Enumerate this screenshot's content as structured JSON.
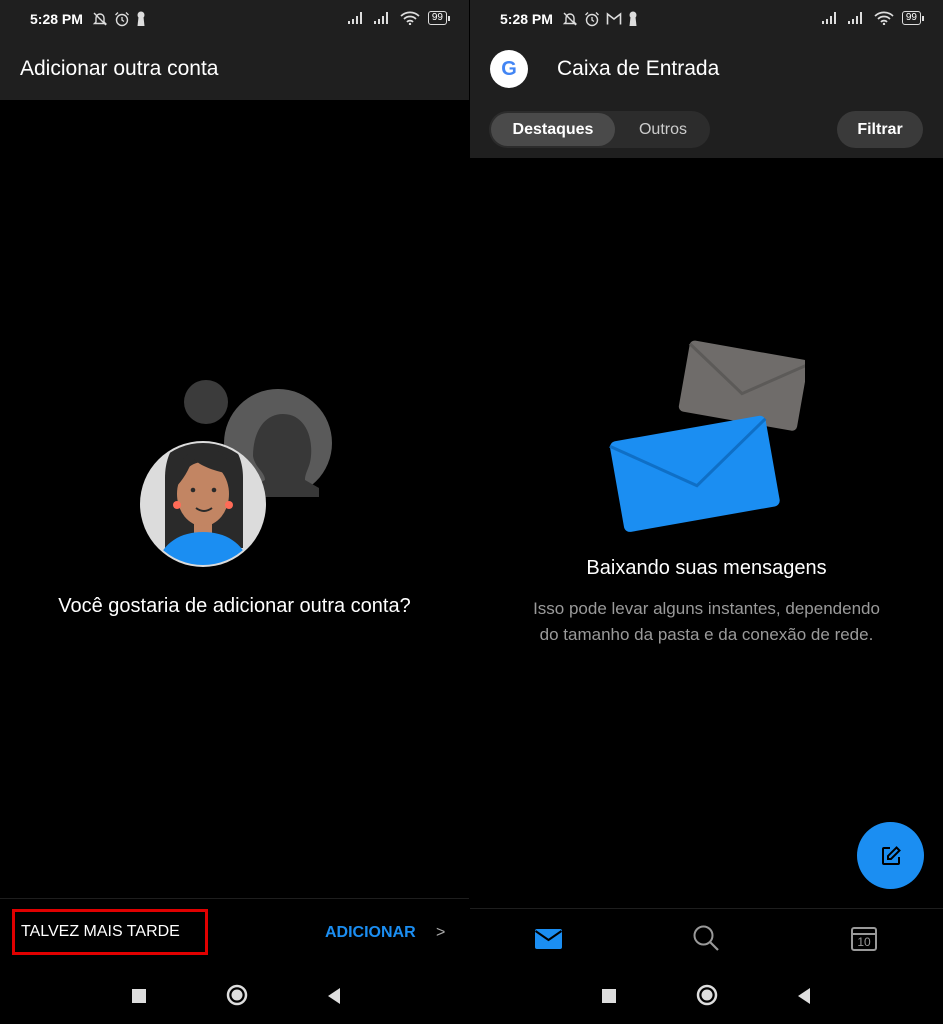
{
  "colors": {
    "accent": "#1b8ef2",
    "highlight_box": "#e00000",
    "bar_bg": "#1f1f1f"
  },
  "left": {
    "status": {
      "time": "5:28 PM",
      "battery": "99"
    },
    "title": "Adicionar outra conta",
    "question": "Você gostaria de adicionar outra conta?",
    "later_label": "TALVEZ MAIS TARDE",
    "add_label": "ADICIONAR",
    "add_chevron": ">"
  },
  "right": {
    "status": {
      "time": "5:28 PM",
      "battery": "99"
    },
    "account_icon": "G",
    "title": "Caixa de Entrada",
    "tabs": [
      {
        "label": "Destaques",
        "selected": true
      },
      {
        "label": "Outros",
        "selected": false
      }
    ],
    "filter_label": "Filtrar",
    "downloading_title": "Baixando suas mensagens",
    "downloading_body": "Isso pode levar alguns instantes, dependendo do tamanho da pasta e da conexão de rede.",
    "calendar_day": "10",
    "bottom_tabs": [
      "mail-icon",
      "search-icon",
      "calendar-icon"
    ]
  },
  "icons": {
    "nav": [
      "square-recent-icon",
      "circle-home-icon",
      "triangle-back-icon"
    ],
    "compose": "compose-icon"
  }
}
